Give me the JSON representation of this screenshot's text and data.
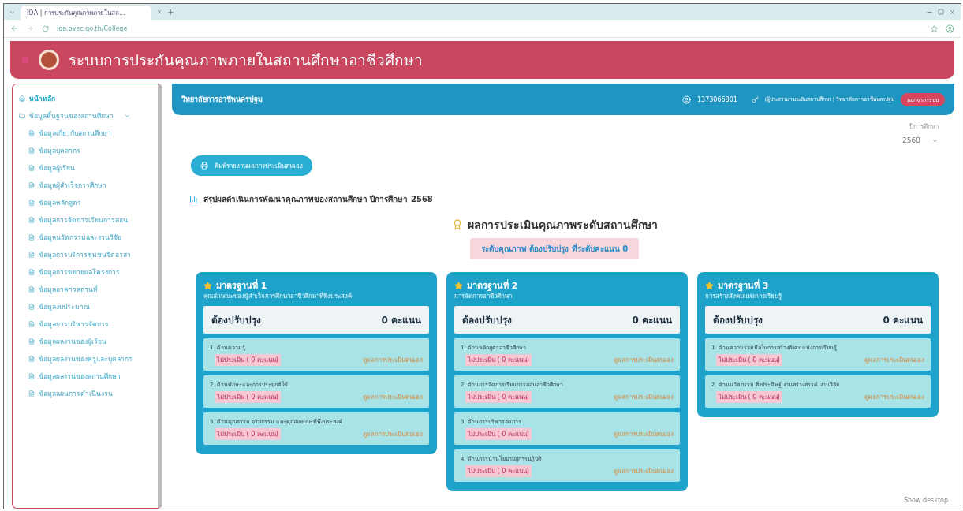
{
  "browser": {
    "tab_title": "IQA | การประกันคุณภาพภายในสถ...",
    "url": "iqa.ovec.go.th/College"
  },
  "header": {
    "title": "ระบบการประกันคุณภาพภายในสถานศึกษาอาชีวศึกษา"
  },
  "topbar": {
    "college": "วิทยาลัยการอาชีพนครปฐม",
    "user_id": "1373066801",
    "role": "(ผู้ประสานงานระดับสถานศึกษา) วิทยาลัยการอาชีพนครปฐม",
    "logout": "ออกจากระบบ"
  },
  "sidebar": {
    "items": [
      {
        "label": "หน้าหลัก",
        "selected": true
      },
      {
        "label": "ข้อมูลพื้นฐานของสถานศึกษา",
        "selected": false,
        "expanded": true,
        "children": [
          {
            "label": "ข้อมูลเกี่ยวกับสถานศึกษา"
          },
          {
            "label": "ข้อมูลบุคลากร"
          },
          {
            "label": "ข้อมูลผู้เรียน"
          },
          {
            "label": "ข้อมูลผู้สำเร็จการศึกษา"
          },
          {
            "label": "ข้อมูลหลักสูตร"
          },
          {
            "label": "ข้อมูลการจัดการเรียนการสอน"
          },
          {
            "label": "ข้อมูลนวัตกรรมและงานวิจัย"
          },
          {
            "label": "ข้อมูลการบริการชุมชนจิตอาสา"
          },
          {
            "label": "ข้อมูลการขยายผลโครงการ"
          },
          {
            "label": "ข้อมูลอาคารสถานที่"
          },
          {
            "label": "ข้อมูลงบประมาณ"
          },
          {
            "label": "ข้อมูลการบริหารจัดการ"
          },
          {
            "label": "ข้อมูลผลงานของผู้เรียน"
          },
          {
            "label": "ข้อมูลผลงานของครูและบุคลากร"
          },
          {
            "label": "ข้อมูลผลงานของสถานศึกษา"
          },
          {
            "label": "ข้อมูลแผนการดำเนินงาน"
          }
        ]
      }
    ]
  },
  "year_select": {
    "label": "ปีการศึกษา",
    "value": "2568"
  },
  "print_button": "พิมพ์รายงานผลการประเมินตนเอง",
  "summary_title": "สรุปผลดำเนินการพัฒนาคุณภาพของสถานศึกษา ปีการศึกษา 2568",
  "result": {
    "title": "ผลการประเมินคุณภาพระดับสถานศึกษา",
    "badge": "ระดับคุณภาพ ต้องปรับปรุง ที่ระดับคะแนน 0"
  },
  "standards": [
    {
      "title": "มาตรฐานที่ 1",
      "subtitle": "คุณลักษณะของผู้สำเร็จการศึกษาอาชีวศึกษาที่พึงประสงค์",
      "level": "ต้องปรับปรุง",
      "score": "0 คะแนน",
      "items": [
        {
          "name": "1. ด้านความรู้",
          "status": "ไม่ประเมิน ( 0 คะแนน)",
          "link": "ดูผลการประเมินตนเอง"
        },
        {
          "name": "2. ด้านทักษะและการประยุกต์ใช้",
          "status": "ไม่ประเมิน ( 0 คะแนน)",
          "link": "ดูผลการประเมินตนเอง"
        },
        {
          "name": "3. ด้านคุณธรรม จริยธรรม และคุณลักษณะที่พึงประสงค์",
          "status": "ไม่ประเมิน ( 0 คะแนน)",
          "link": "ดูผลการประเมินตนเอง"
        }
      ]
    },
    {
      "title": "มาตรฐานที่ 2",
      "subtitle": "การจัดการอาชีวศึกษา",
      "level": "ต้องปรับปรุง",
      "score": "0 คะแนน",
      "items": [
        {
          "name": "1. ด้านหลักสูตรอาชีวศึกษา",
          "status": "ไม่ประเมิน ( 0 คะแนน)",
          "link": "ดูผลการประเมินตนเอง"
        },
        {
          "name": "2. ด้านการจัดการเรียนการสอนอาชีวศึกษา",
          "status": "ไม่ประเมิน ( 0 คะแนน)",
          "link": "ดูผลการประเมินตนเอง"
        },
        {
          "name": "3. ด้านการบริหารจัดการ",
          "status": "ไม่ประเมิน ( 0 คะแนน)",
          "link": "ดูผลการประเมินตนเอง"
        },
        {
          "name": "4. ด้านการนำนโยบายสู่การปฏิบัติ",
          "status": "ไม่ประเมิน ( 0 คะแนน)",
          "link": "ดูผลการประเมินตนเอง"
        }
      ]
    },
    {
      "title": "มาตรฐานที่ 3",
      "subtitle": "การสร้างสังคมแห่งการเรียนรู้",
      "level": "ต้องปรับปรุง",
      "score": "0 คะแนน",
      "items": [
        {
          "name": "1. ด้านความร่วมมือในการสร้างสังคมแห่งการเรียนรู้",
          "status": "ไม่ประเมิน ( 0 คะแนน)",
          "link": "ดูผลการประเมินตนเอง"
        },
        {
          "name": "2. ด้านนวัตกรรม สิ่งประดิษฐ์ งานสร้างสรรค์ งานวิจัย",
          "status": "ไม่ประเมิน ( 0 คะแนน)",
          "link": "ดูผลการประเมินตนเอง"
        }
      ]
    }
  ],
  "footer_note": "Show desktop"
}
